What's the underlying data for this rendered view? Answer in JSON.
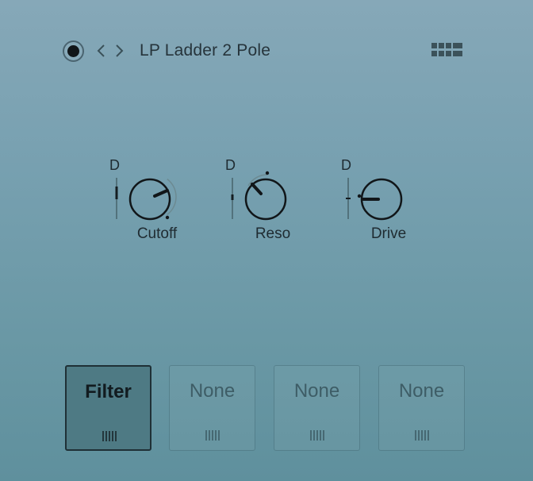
{
  "header": {
    "preset_name": "LP Ladder 2 Pole",
    "icons": {
      "power": "power-toggle-icon",
      "prev": "chevron-left-icon",
      "next": "chevron-right-icon",
      "grid": "grid-icon"
    }
  },
  "knobs": [
    {
      "name": "Cutoff",
      "mod_label": "D"
    },
    {
      "name": "Reso",
      "mod_label": "D"
    },
    {
      "name": "Drive",
      "mod_label": "D"
    }
  ],
  "slots": [
    {
      "label": "Filter",
      "active": true
    },
    {
      "label": "None",
      "active": false
    },
    {
      "label": "None",
      "active": false
    },
    {
      "label": "None",
      "active": false
    }
  ],
  "colors": {
    "background_top": "#86a8b8",
    "background_bottom": "#5f909d",
    "active_slot": "#4e7a84",
    "text": "#1f2b31"
  }
}
